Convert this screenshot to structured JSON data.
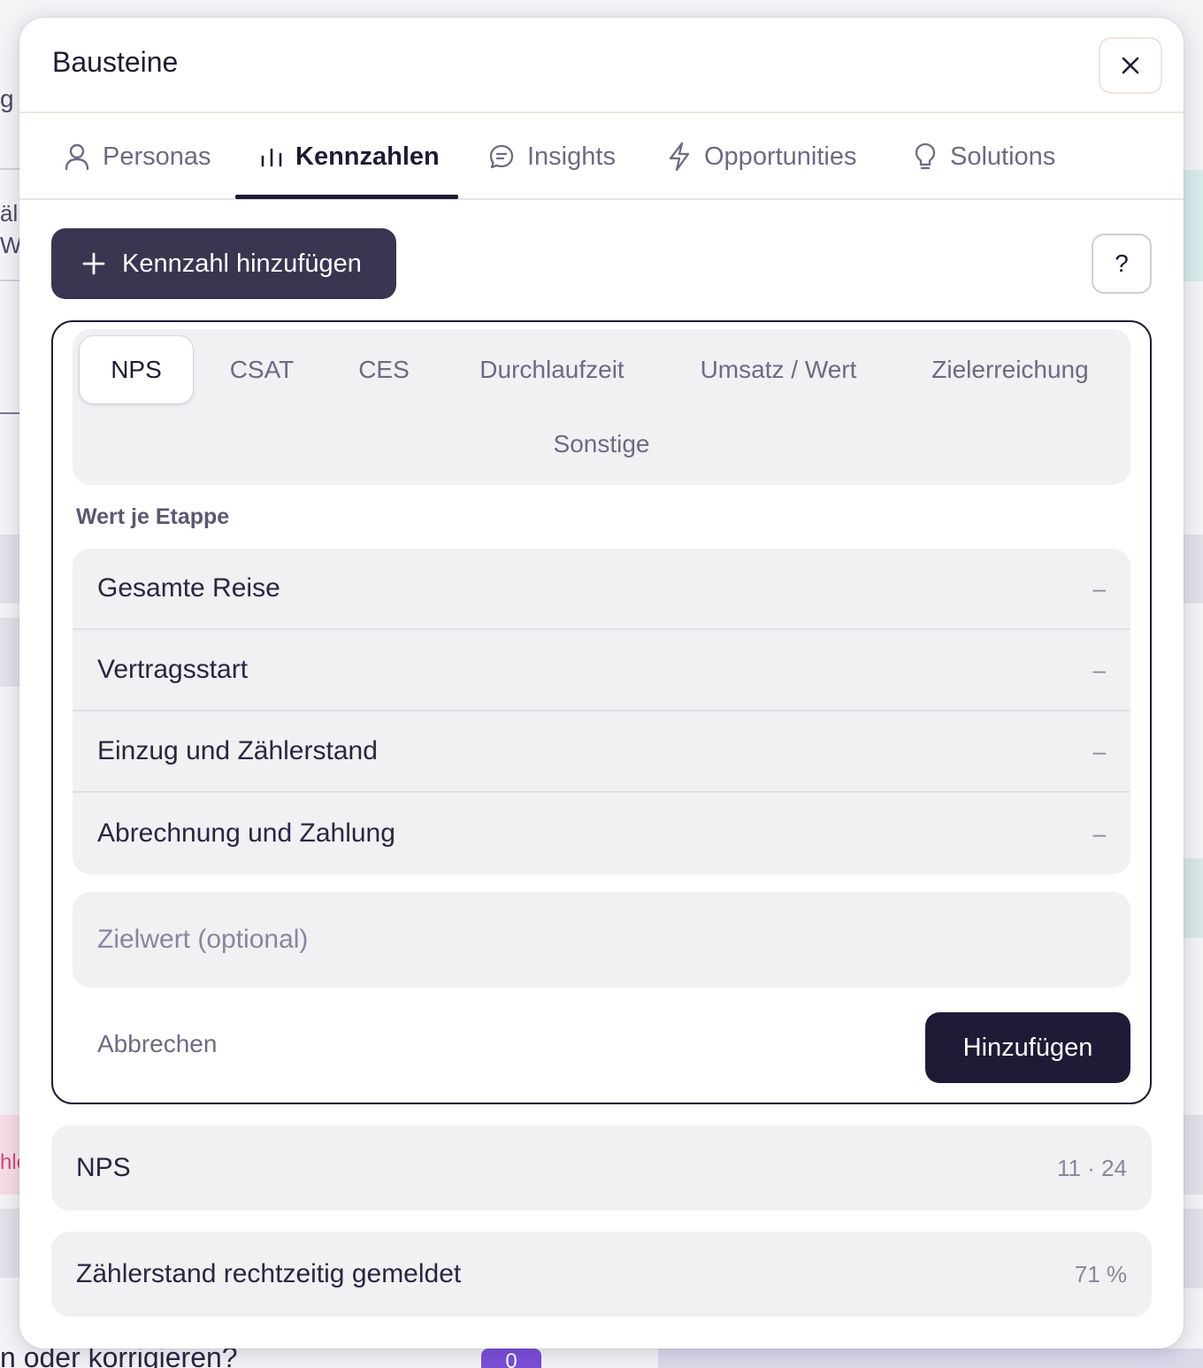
{
  "modal": {
    "title": "Bausteine"
  },
  "tabs": [
    {
      "label": "Personas",
      "icon": "person-icon",
      "active": false
    },
    {
      "label": "Kennzahlen",
      "icon": "bar-chart-icon",
      "active": true
    },
    {
      "label": "Insights",
      "icon": "chat-bubble-icon",
      "active": false
    },
    {
      "label": "Opportunities",
      "icon": "lightning-icon",
      "active": false
    },
    {
      "label": "Solutions",
      "icon": "lightbulb-icon",
      "active": false
    }
  ],
  "toolbar": {
    "add_label": "Kennzahl hinzufügen",
    "help_label": "?"
  },
  "form": {
    "metric_types": [
      {
        "label": "NPS",
        "active": true
      },
      {
        "label": "CSAT",
        "active": false
      },
      {
        "label": "CES",
        "active": false
      },
      {
        "label": "Durchlaufzeit",
        "active": false
      },
      {
        "label": "Umsatz / Wert",
        "active": false
      },
      {
        "label": "Zielerreichung",
        "active": false
      },
      {
        "label": "Sonstige",
        "active": false
      }
    ],
    "section_label": "Wert je Etappe",
    "stages": [
      {
        "name": "Gesamte Reise",
        "value": "–"
      },
      {
        "name": "Vertragsstart",
        "value": "–"
      },
      {
        "name": "Einzug und Zählerstand",
        "value": "–"
      },
      {
        "name": "Abrechnung und Zahlung",
        "value": "–"
      }
    ],
    "target_placeholder": "Zielwert (optional)",
    "cancel_label": "Abbrechen",
    "submit_label": "Hinzufügen"
  },
  "metrics": [
    {
      "name": "NPS",
      "value": "11 · 24"
    },
    {
      "name": "Zählerstand rechtzeitig gemeldet",
      "value": "71 %"
    }
  ],
  "background": {
    "fragment_1": "g",
    "fragment_2": "äl",
    "fragment_3": "W",
    "fragment_4": "hle",
    "bottom_text": "n oder korrigieren?",
    "badge": "0"
  }
}
